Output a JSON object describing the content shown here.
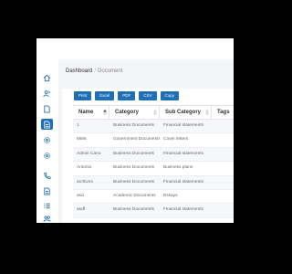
{
  "breadcrumb": {
    "root": "Dashboard",
    "separator": "/",
    "current": "Document"
  },
  "sidebar": {
    "items": [
      {
        "icon": "home-icon"
      },
      {
        "icon": "users-icon"
      },
      {
        "icon": "file-icon"
      },
      {
        "icon": "document-icon",
        "active": true
      },
      {
        "icon": "gear-icon"
      },
      {
        "icon": "settings-icon"
      },
      {
        "icon": "phone-icon"
      },
      {
        "icon": "file-text-icon"
      },
      {
        "icon": "list-icon"
      },
      {
        "icon": "users-group-icon"
      }
    ]
  },
  "toolbar": {
    "buttons": [
      "Print",
      "Excel",
      "PDF",
      "CSV",
      "Copy"
    ]
  },
  "table": {
    "columns": [
      "Name",
      "Category",
      "Sub Category",
      "Tags"
    ],
    "rows": [
      [
        "1",
        "Business Documents",
        "Financial statements",
        ""
      ],
      [
        "6666",
        "Government Documents",
        "Cover letters",
        ""
      ],
      [
        "Admin Cano",
        "Business Documents",
        "Financial statements",
        ""
      ],
      [
        "Antonio",
        "Business Documents",
        "Business plans",
        ""
      ],
      [
        "archivos",
        "Business Documents",
        "Financial statements",
        ""
      ],
      [
        "asd",
        "Academic Documents",
        "Essays",
        ""
      ],
      [
        "asdf",
        "Business Documents",
        "Financial statements",
        ""
      ]
    ]
  },
  "colors": {
    "accent": "#1f6fb5",
    "background": "#f4f5f7"
  }
}
